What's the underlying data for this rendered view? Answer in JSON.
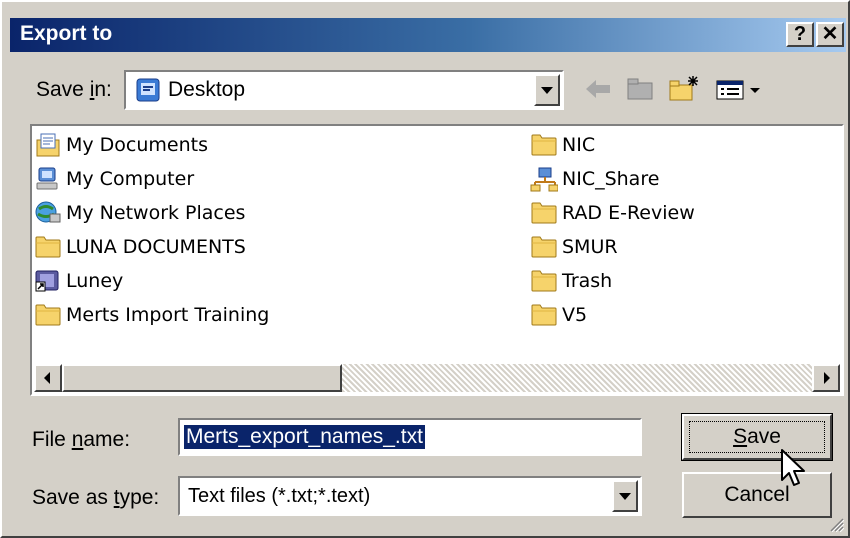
{
  "window": {
    "title": "Export to"
  },
  "titlebar": {
    "help_label": "?",
    "close_label": "✕"
  },
  "save_in": {
    "label_pre": "Save ",
    "label_key": "i",
    "label_post": "n:",
    "value": "Desktop"
  },
  "items_left": [
    {
      "label": "My Documents",
      "icon": "my-documents-icon"
    },
    {
      "label": "My Computer",
      "icon": "my-computer-icon"
    },
    {
      "label": "My Network Places",
      "icon": "network-places-icon"
    },
    {
      "label": "LUNA DOCUMENTS",
      "icon": "folder-icon"
    },
    {
      "label": "Luney",
      "icon": "shortcut-icon"
    },
    {
      "label": "Merts Import Training",
      "icon": "folder-icon"
    }
  ],
  "items_right": [
    {
      "label": "NIC",
      "icon": "folder-icon"
    },
    {
      "label": "NIC_Share",
      "icon": "network-share-icon"
    },
    {
      "label": "RAD E-Review",
      "icon": "folder-icon"
    },
    {
      "label": "SMUR",
      "icon": "folder-icon"
    },
    {
      "label": "Trash",
      "icon": "folder-icon"
    },
    {
      "label": "V5",
      "icon": "folder-icon"
    }
  ],
  "file_name": {
    "label_pre": "File ",
    "label_key": "n",
    "label_post": "ame:",
    "value": "Merts_export_names_.txt"
  },
  "save_as_type": {
    "label_pre": "Save as ",
    "label_key": "t",
    "label_post": "ype:",
    "value": "Text files (*.txt;*.text)"
  },
  "buttons": {
    "save_key": "S",
    "save_rest": "ave",
    "cancel": "Cancel"
  }
}
